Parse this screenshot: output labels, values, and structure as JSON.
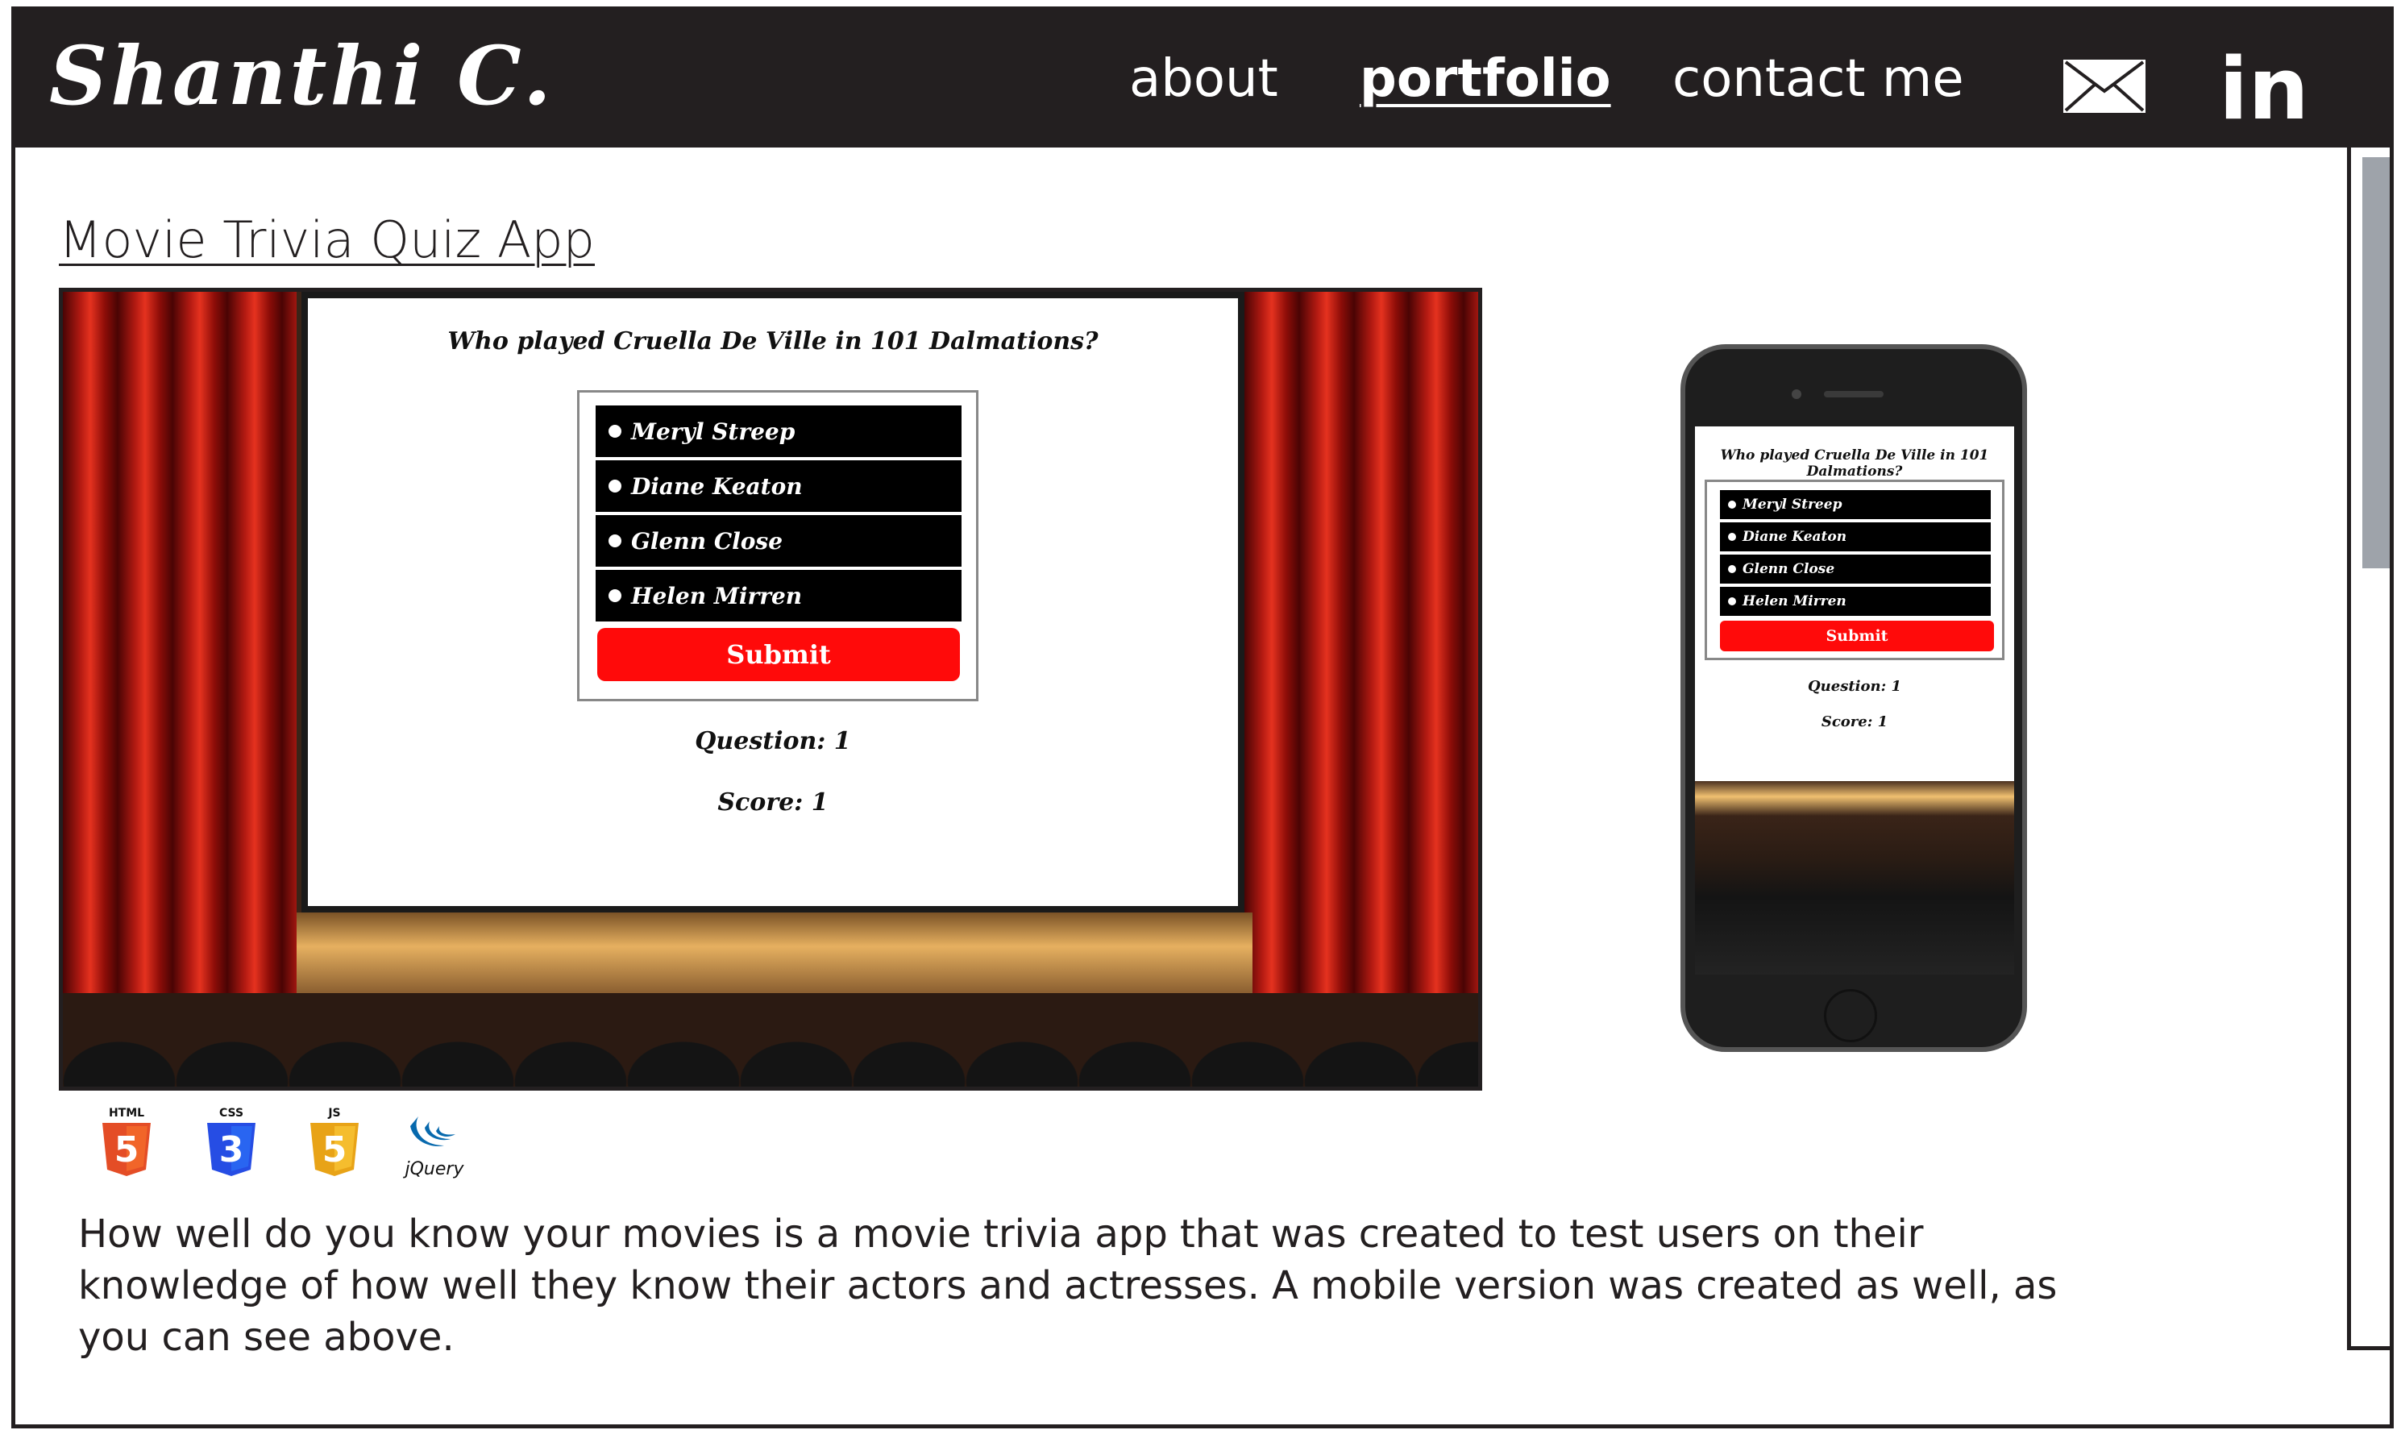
{
  "header": {
    "brand": "Shanthi C.",
    "nav": [
      {
        "label": "about",
        "active": false
      },
      {
        "label": "portfolio",
        "active": true
      },
      {
        "label": "contact me",
        "active": false
      }
    ],
    "icons": [
      "mail-icon",
      "linkedin-icon"
    ],
    "linkedin_label": "in"
  },
  "project": {
    "title": "Movie Trivia Quiz App",
    "quiz": {
      "question": "Who played Cruella De Ville in 101 Dalmations?",
      "answers": [
        "Meryl Streep",
        "Diane Keaton",
        "Glenn Close",
        "Helen Mirren"
      ],
      "submit_label": "Submit",
      "question_label": "Question: 1",
      "score_label": "Score: 1"
    },
    "tech": [
      {
        "name": "html5-icon",
        "label": "HTML",
        "glyph": "5",
        "color": "#e44d26"
      },
      {
        "name": "css3-icon",
        "label": "CSS",
        "glyph": "3",
        "color": "#264de4"
      },
      {
        "name": "js-icon",
        "label": "JS",
        "glyph": "5",
        "color": "#f0a020"
      },
      {
        "name": "jquery-icon",
        "label": "jQuery",
        "color": "#0769ad"
      }
    ],
    "description": "How well do you know your movies is a movie trivia app that was created to test users on their knowledge of how well they know their actors and actresses. A mobile version was created as well, as you can see above."
  },
  "colors": {
    "header_bg": "#231f20",
    "submit": "#ff0a0a",
    "scroll_thumb": "#9ea3aa"
  }
}
